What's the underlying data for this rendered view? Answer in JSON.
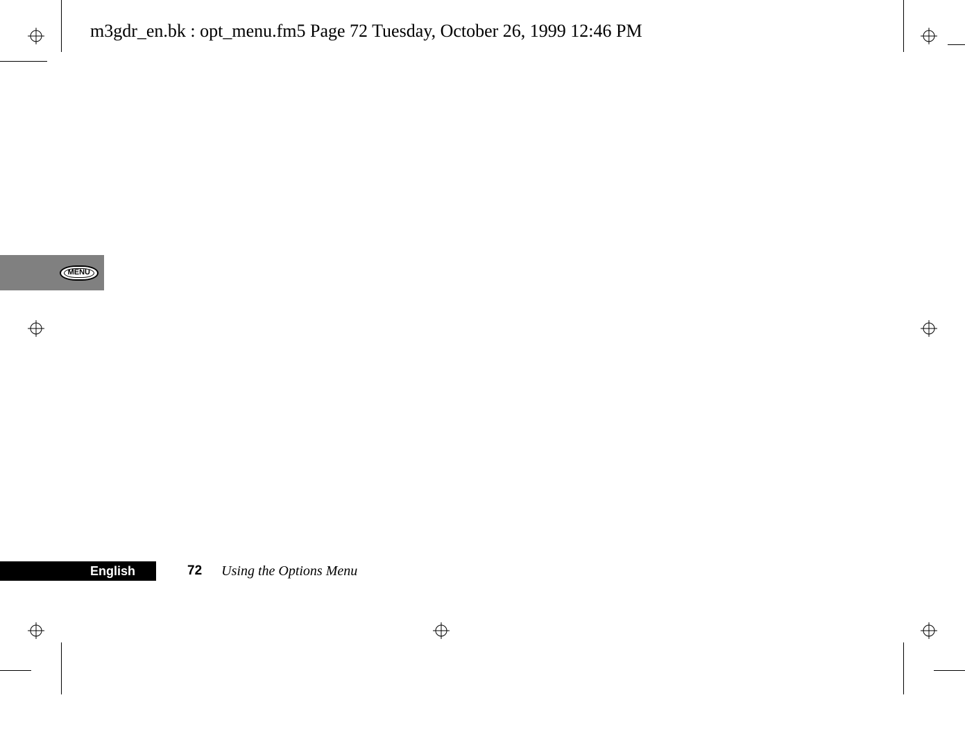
{
  "header": {
    "text": "m3gdr_en.bk : opt_menu.fm5  Page 72  Tuesday, October 26, 1999  12:46 PM"
  },
  "menu_button": {
    "label": "MENU"
  },
  "footer": {
    "language": "English",
    "page_number": "72",
    "section_title": "Using the Options Menu"
  }
}
